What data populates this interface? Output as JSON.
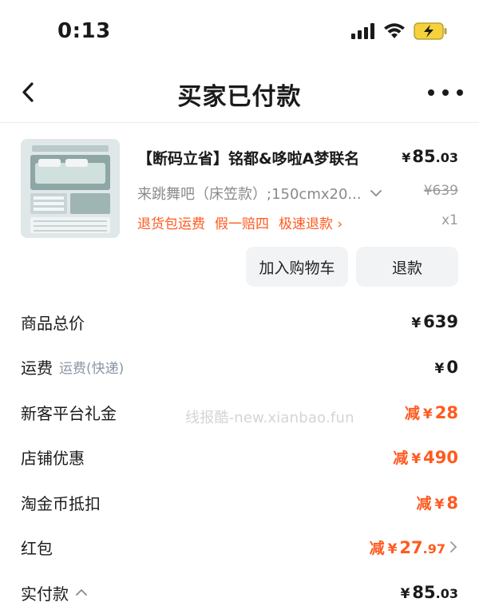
{
  "status_bar": {
    "time": "0:13"
  },
  "nav": {
    "title": "买家已付款"
  },
  "product": {
    "title": "【断码立省】铭都&哆啦A梦联名",
    "price_yen": "¥",
    "price_int": "85",
    "price_dec": ".03",
    "sku": "来跳舞吧（床笠款）;150cmx20...",
    "original_price": "¥639",
    "tags": [
      "退货包运费",
      "假一赔四",
      "极速退款 ›"
    ],
    "quantity": "x1"
  },
  "actions": {
    "add_cart": "加入购物车",
    "refund": "退款"
  },
  "summary": {
    "total_label": "商品总价",
    "total_value": "639",
    "shipping_label": "运费",
    "shipping_sub": "运费(快递)",
    "shipping_value": "0",
    "newbie_label": "新客平台礼金",
    "newbie_value": "28",
    "store_label": "店铺优惠",
    "store_value": "490",
    "coin_label": "淘金币抵扣",
    "coin_value": "8",
    "redpack_label": "红包",
    "redpack_int": "27",
    "redpack_dec": ".97",
    "paid_label": "实付款",
    "paid_int": "85",
    "paid_dec": ".03",
    "minus": "减",
    "yen": "¥"
  },
  "watermark": "线报酷-new.xianbao.fun",
  "colors": {
    "accent": "#ff5a1f",
    "muted": "#8a8a8a",
    "button_bg": "#f1f3f5"
  }
}
